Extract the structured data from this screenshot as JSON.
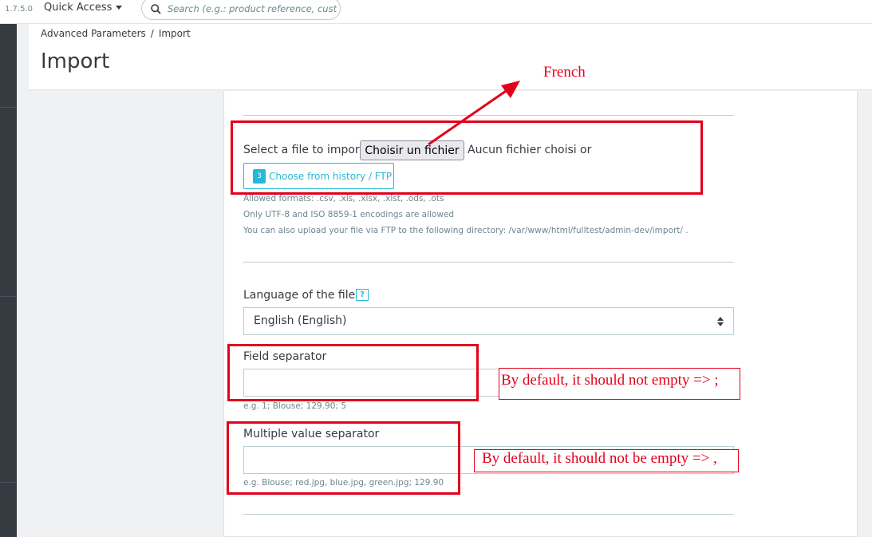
{
  "topbar": {
    "version": "1.7.5.0",
    "quick_access": "Quick Access",
    "search_placeholder": "Search (e.g.: product reference, custome"
  },
  "header": {
    "breadcrumb": [
      "Advanced Parameters",
      "Import"
    ],
    "breadcrumb_separator": "/",
    "title": "Import"
  },
  "file_section": {
    "select_label": "Select a file to import",
    "choose_file_button": "Choisir un fichier",
    "no_file_text": "Aucun fichier choisi",
    "or_text": "or",
    "history_badge": "3",
    "history_button": "Choose from history / FTP",
    "help_formats": "Allowed formats: .csv, .xls, .xlsx, .xlst, .ods, .ots",
    "help_encodings": "Only UTF-8 and ISO 8859-1 encodings are allowed",
    "help_ftp": "You can also upload your file via FTP to the following directory: /var/www/html/fulltest/admin-dev/import/ ."
  },
  "language": {
    "label": "Language of the file",
    "help_icon": "?",
    "selected": "English (English)"
  },
  "field_separator": {
    "label": "Field separator",
    "value": "",
    "help": "e.g. 1; Blouse; 129.90; 5"
  },
  "multiple_value_separator": {
    "label": "Multiple value separator",
    "value": "",
    "help": "e.g. Blouse; red.jpg, blue.jpg, green.jpg; 129.90"
  },
  "annotations": {
    "french": "French",
    "field_separator_note": "By default, it should not empty => ;",
    "multiple_value_note": "By default, it should not be empty => ,"
  },
  "colors": {
    "accent": "#25b9d7",
    "annotation_red": "#e3001b",
    "sidebar": "#363a41"
  }
}
